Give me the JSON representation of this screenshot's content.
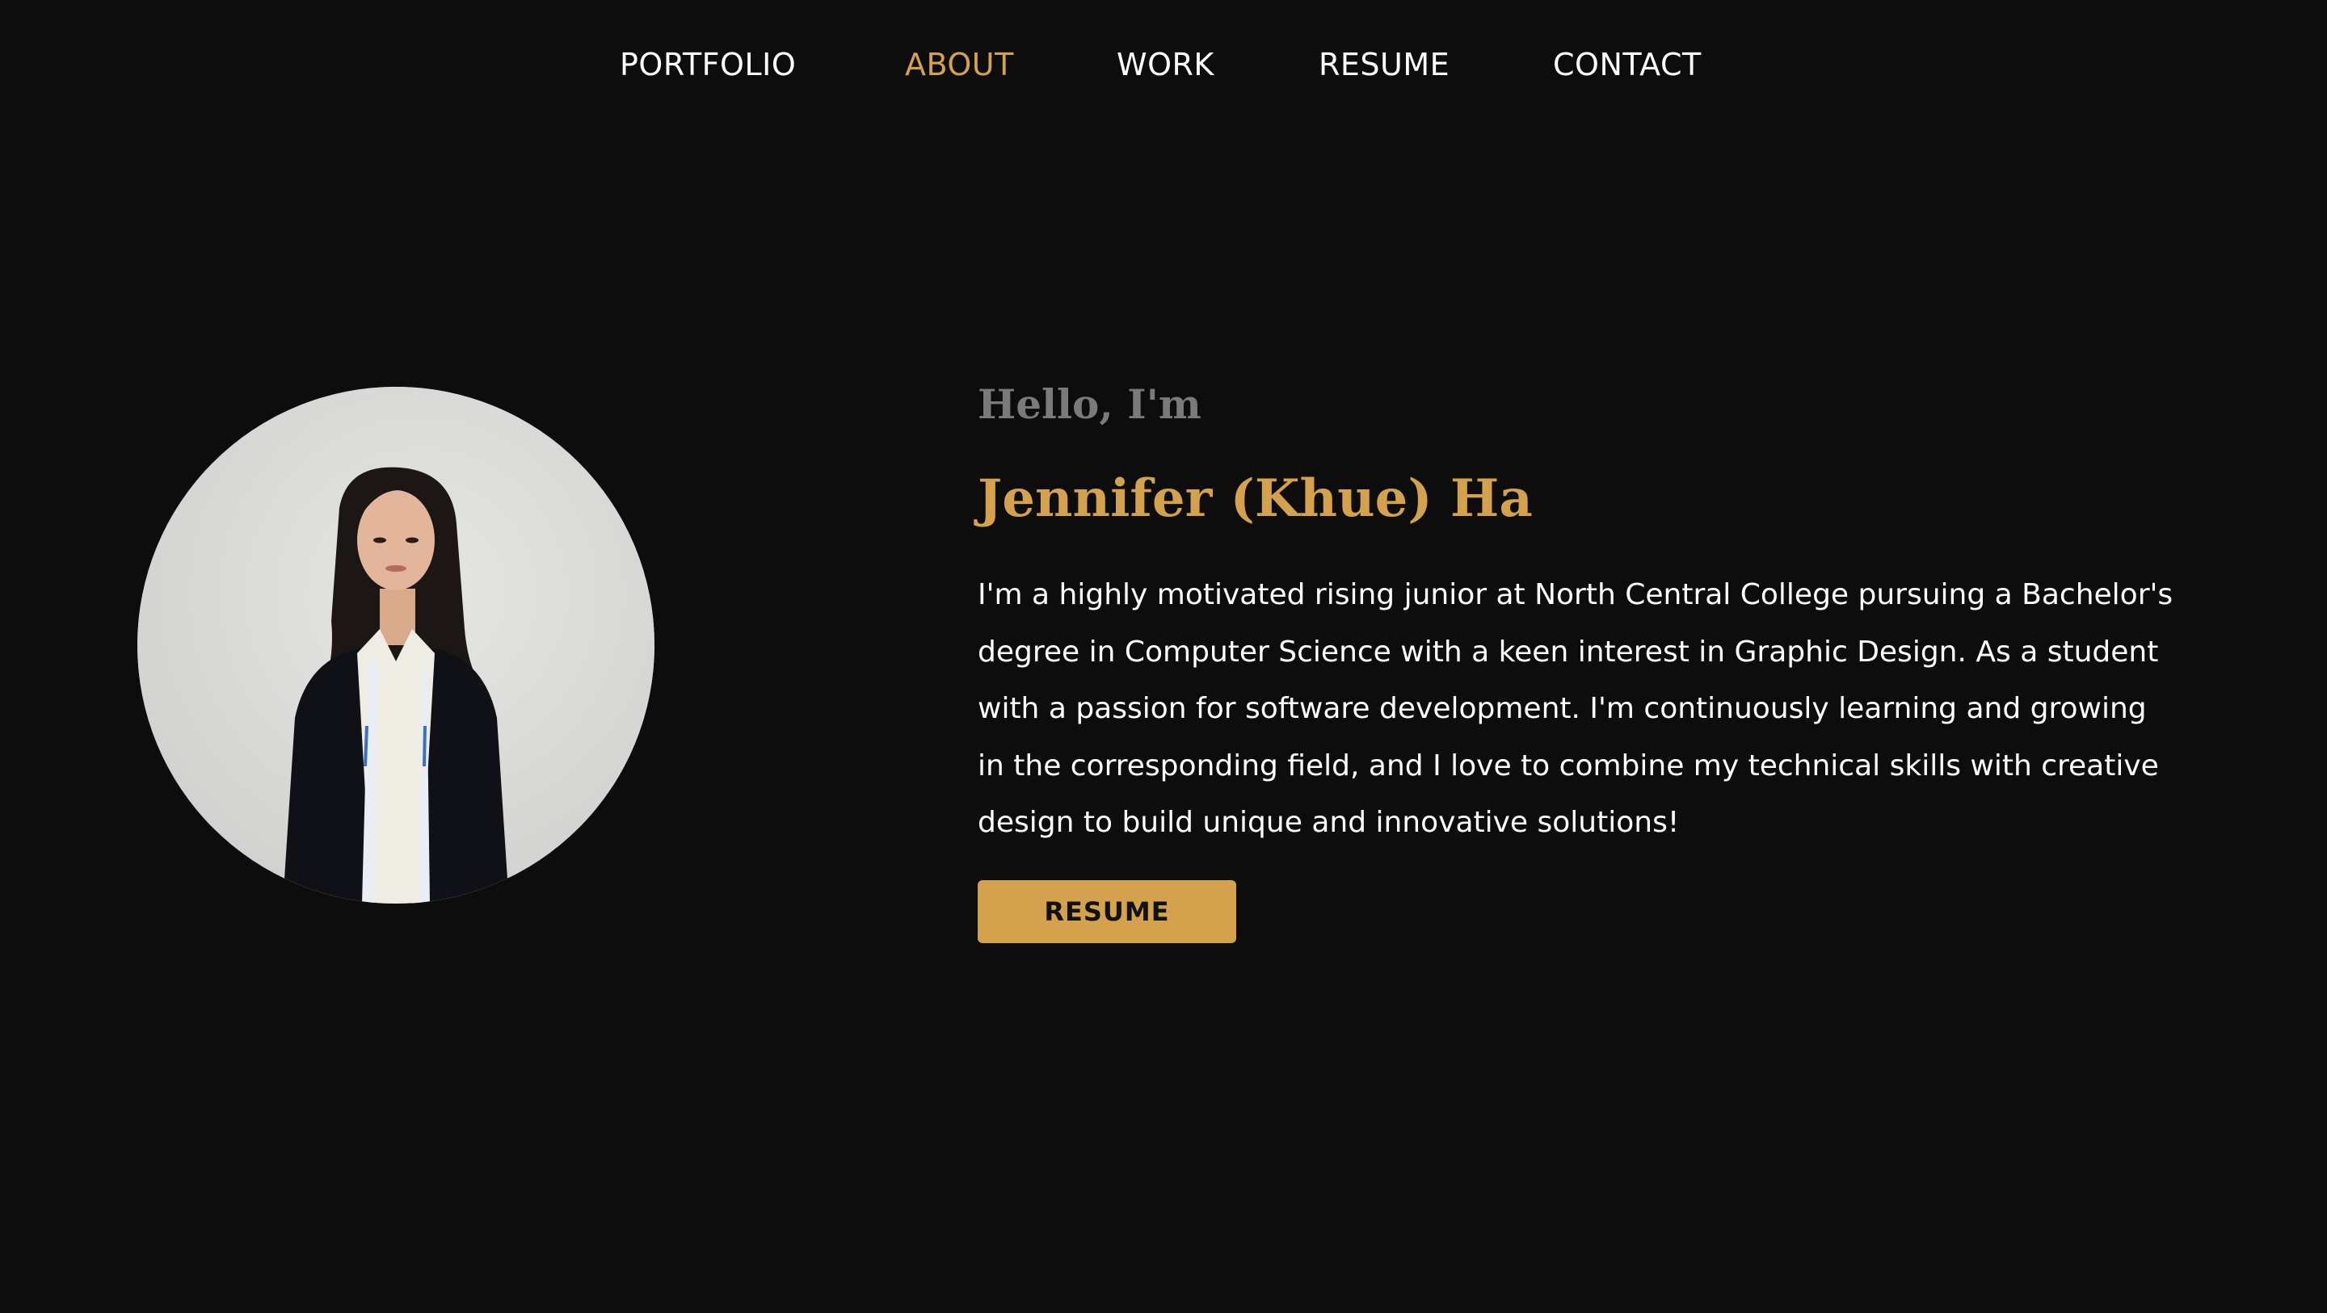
{
  "nav": {
    "items": [
      {
        "label": "PORTFOLIO"
      },
      {
        "label": "ABOUT"
      },
      {
        "label": "WORK"
      },
      {
        "label": "RESUME"
      },
      {
        "label": "CONTACT"
      }
    ],
    "active": "ABOUT"
  },
  "about": {
    "greeting": "Hello, I'm",
    "name": "Jennifer (Khue) Ha",
    "bio_lines": [
      "I'm a highly motivated rising junior at North Central College pursuing a Bachelor's",
      "degree in Computer Science with a keen interest in Graphic Design. As a student",
      "with a passion for software development. I'm continuously learning and growing",
      "in the corresponding field, and I love to combine my technical skills with creative",
      "design to build unique and innovative solutions!"
    ],
    "resume_button_label": "RESUME"
  },
  "colors": {
    "background": "#0d0d0d",
    "accent": "#d4a24c",
    "greeting": "#7a7a7a",
    "text": "#ffffff"
  }
}
